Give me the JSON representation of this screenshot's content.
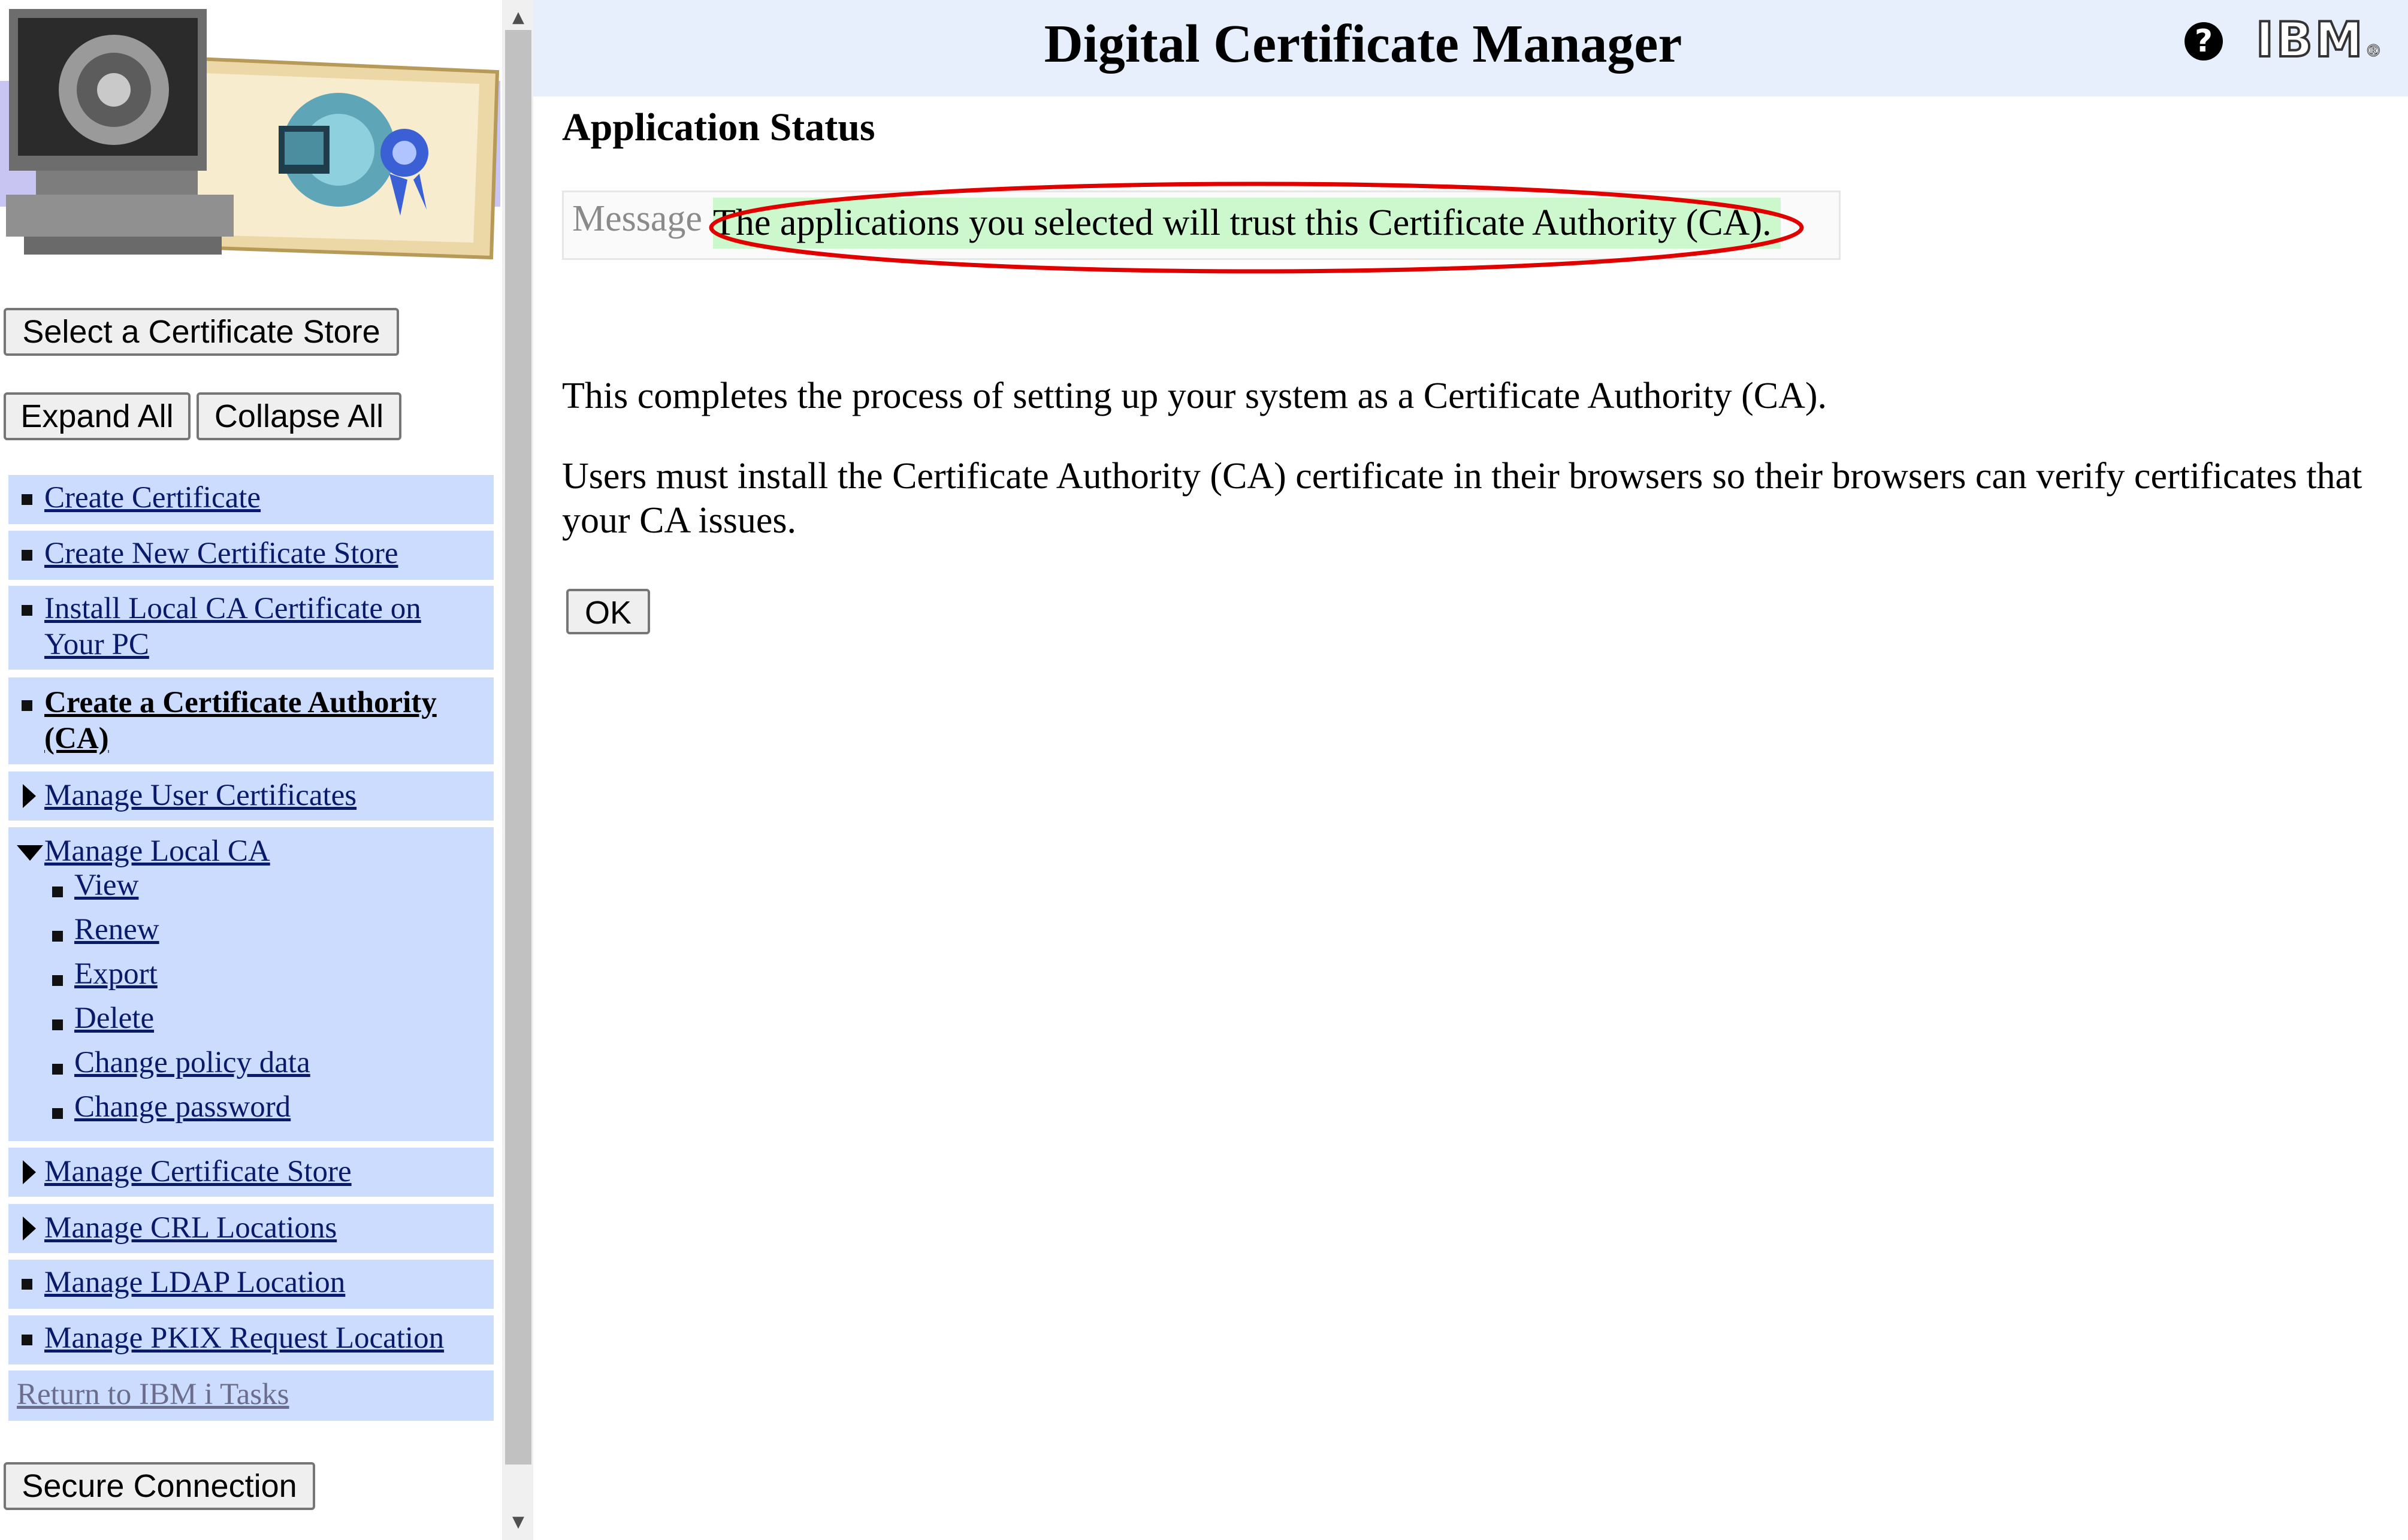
{
  "header": {
    "title": "Digital Certificate Manager",
    "ibm_logo": "IBM",
    "help_icon": "help-icon"
  },
  "main": {
    "section_title": "Application Status",
    "message_label": "Message",
    "message_text": "The applications you selected will trust this Certificate Authority (CA).",
    "para1": "This completes the process of setting up your system as a Certificate Authority (CA).",
    "para2": "Users must install the Certificate Authority (CA) certificate in their browsers so their browsers can verify certificates that your CA issues.",
    "ok_label": "OK"
  },
  "sidebar": {
    "select_store_label": "Select a Certificate Store",
    "expand_all_label": "Expand All",
    "collapse_all_label": "Collapse All",
    "items": [
      {
        "label": "Create Certificate"
      },
      {
        "label": "Create New Certificate Store"
      },
      {
        "label": "Install Local CA Certificate on Your PC"
      },
      {
        "label": "Create a Certificate Authority (CA)"
      },
      {
        "label": "Manage User Certificates"
      },
      {
        "label": "Manage Local CA",
        "children": [
          "View",
          "Renew",
          "Export",
          "Delete",
          "Change policy data",
          "Change password"
        ]
      },
      {
        "label": "Manage Certificate Store"
      },
      {
        "label": "Manage CRL Locations"
      },
      {
        "label": "Manage LDAP Location"
      },
      {
        "label": "Manage PKIX Request Location"
      },
      {
        "label": "Return to IBM i Tasks"
      }
    ],
    "secure_connection_label": "Secure Connection"
  },
  "colors": {
    "header_bg": "#e7effd",
    "nav_bg": "#cbdcff",
    "message_bg": "#cdf7cd",
    "highlight_ring": "#e00000"
  }
}
